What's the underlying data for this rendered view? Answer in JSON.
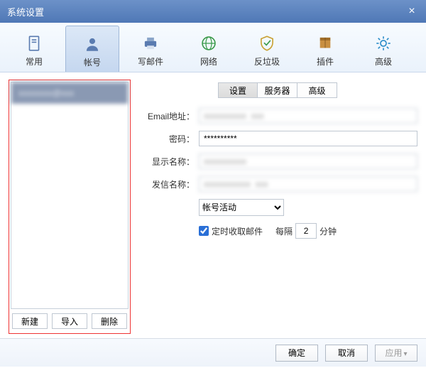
{
  "title": "系统设置",
  "toolbar": [
    {
      "key": "common",
      "label": "常用",
      "active": false
    },
    {
      "key": "account",
      "label": "帐号",
      "active": true
    },
    {
      "key": "compose",
      "label": "写邮件",
      "active": false
    },
    {
      "key": "network",
      "label": "网络",
      "active": false
    },
    {
      "key": "spam",
      "label": "反垃圾",
      "active": false
    },
    {
      "key": "plugin",
      "label": "插件",
      "active": false
    },
    {
      "key": "advanced",
      "label": "高级",
      "active": false
    }
  ],
  "left": {
    "account_placeholder": "xxxxxxxx@xxx",
    "buttons": {
      "new": "新建",
      "import": "导入",
      "delete": "删除"
    }
  },
  "subtabs": {
    "settings": "设置",
    "server": "服务器",
    "advanced": "高级"
  },
  "form": {
    "email_label": "Email地址：",
    "email_value": "xxxxxxxxxx  xxx",
    "password_label": "密码：",
    "password_value": "**********",
    "display_label": "显示名称：",
    "display_value": "xxxxxxxxxx",
    "sender_label": "发信名称：",
    "sender_value": "xxxxxxxxxxx  xxx",
    "activity_label": "帐号活动",
    "timer_check": "定时收取邮件",
    "timer_every": "每隔",
    "timer_value": "2",
    "timer_unit": "分钟"
  },
  "footer": {
    "ok": "确定",
    "cancel": "取消",
    "apply": "应用"
  }
}
